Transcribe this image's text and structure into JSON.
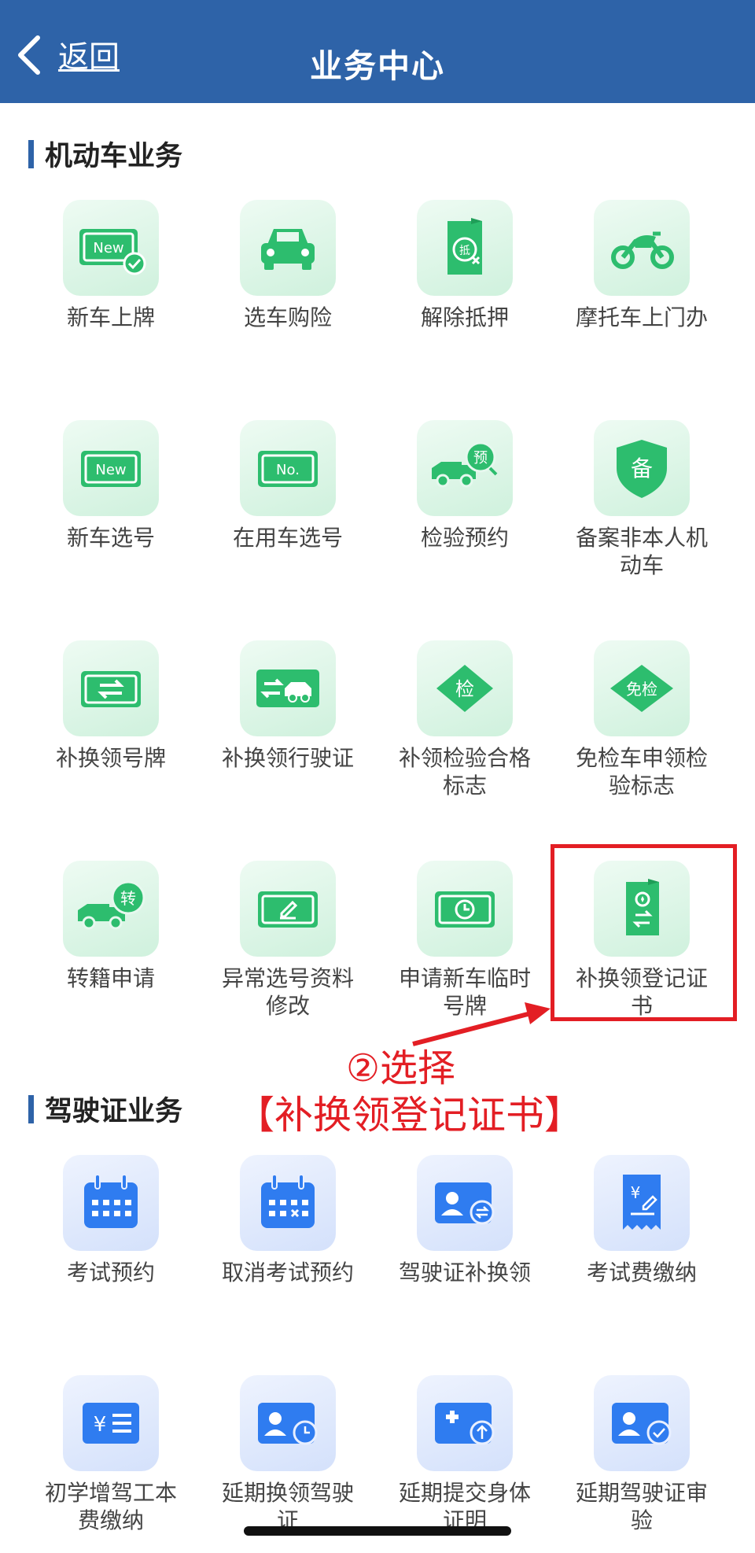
{
  "header": {
    "back_label": "返回",
    "title": "业务中心"
  },
  "sections": [
    {
      "title": "机动车业务",
      "items": [
        {
          "label": "新车上牌",
          "icon": "new-plate-check-icon"
        },
        {
          "label": "选车购险",
          "icon": "car-icon"
        },
        {
          "label": "解除抵押",
          "icon": "mortgage-document-icon"
        },
        {
          "label": "摩托车上门办",
          "icon": "motorcycle-icon"
        },
        {
          "label": "新车选号",
          "icon": "new-plate-icon"
        },
        {
          "label": "在用车选号",
          "icon": "number-plate-icon"
        },
        {
          "label": "检验预约",
          "icon": "truck-appointment-icon"
        },
        {
          "label": "备案非本人机动车",
          "icon": "shield-record-icon"
        },
        {
          "label": "补换领号牌",
          "icon": "plate-exchange-icon"
        },
        {
          "label": "补换领行驶证",
          "icon": "license-exchange-car-icon"
        },
        {
          "label": "补领检验合格标志",
          "icon": "inspection-diamond-icon"
        },
        {
          "label": "免检车申领检验标志",
          "icon": "exempt-diamond-icon"
        },
        {
          "label": "转籍申请",
          "icon": "truck-transfer-icon"
        },
        {
          "label": "异常选号资料修改",
          "icon": "plate-edit-icon"
        },
        {
          "label": "申请新车临时号牌",
          "icon": "plate-clock-icon"
        },
        {
          "label": "补换领登记证书",
          "icon": "certificate-exchange-icon"
        }
      ]
    },
    {
      "title": "驾驶证业务",
      "items": [
        {
          "label": "考试预约",
          "icon": "calendar-icon"
        },
        {
          "label": "取消考试预约",
          "icon": "calendar-cancel-icon"
        },
        {
          "label": "驾驶证补换领",
          "icon": "id-card-exchange-icon"
        },
        {
          "label": "考试费缴纳",
          "icon": "fee-receipt-icon"
        },
        {
          "label": "初学增驾工本费缴纳",
          "icon": "yuan-list-icon"
        },
        {
          "label": "延期换领驾驶证",
          "icon": "id-card-clock-icon"
        },
        {
          "label": "延期提交身体证明",
          "icon": "medical-upload-icon"
        },
        {
          "label": "延期驾驶证审验",
          "icon": "id-card-check-icon"
        }
      ]
    }
  ],
  "annotation": {
    "step": "②选择",
    "target": "【补换领登记证书】"
  },
  "colors": {
    "header": "#2e63a8",
    "green": "#2dbd6e",
    "blue": "#2f7cf0",
    "annotation": "#e31e24"
  }
}
